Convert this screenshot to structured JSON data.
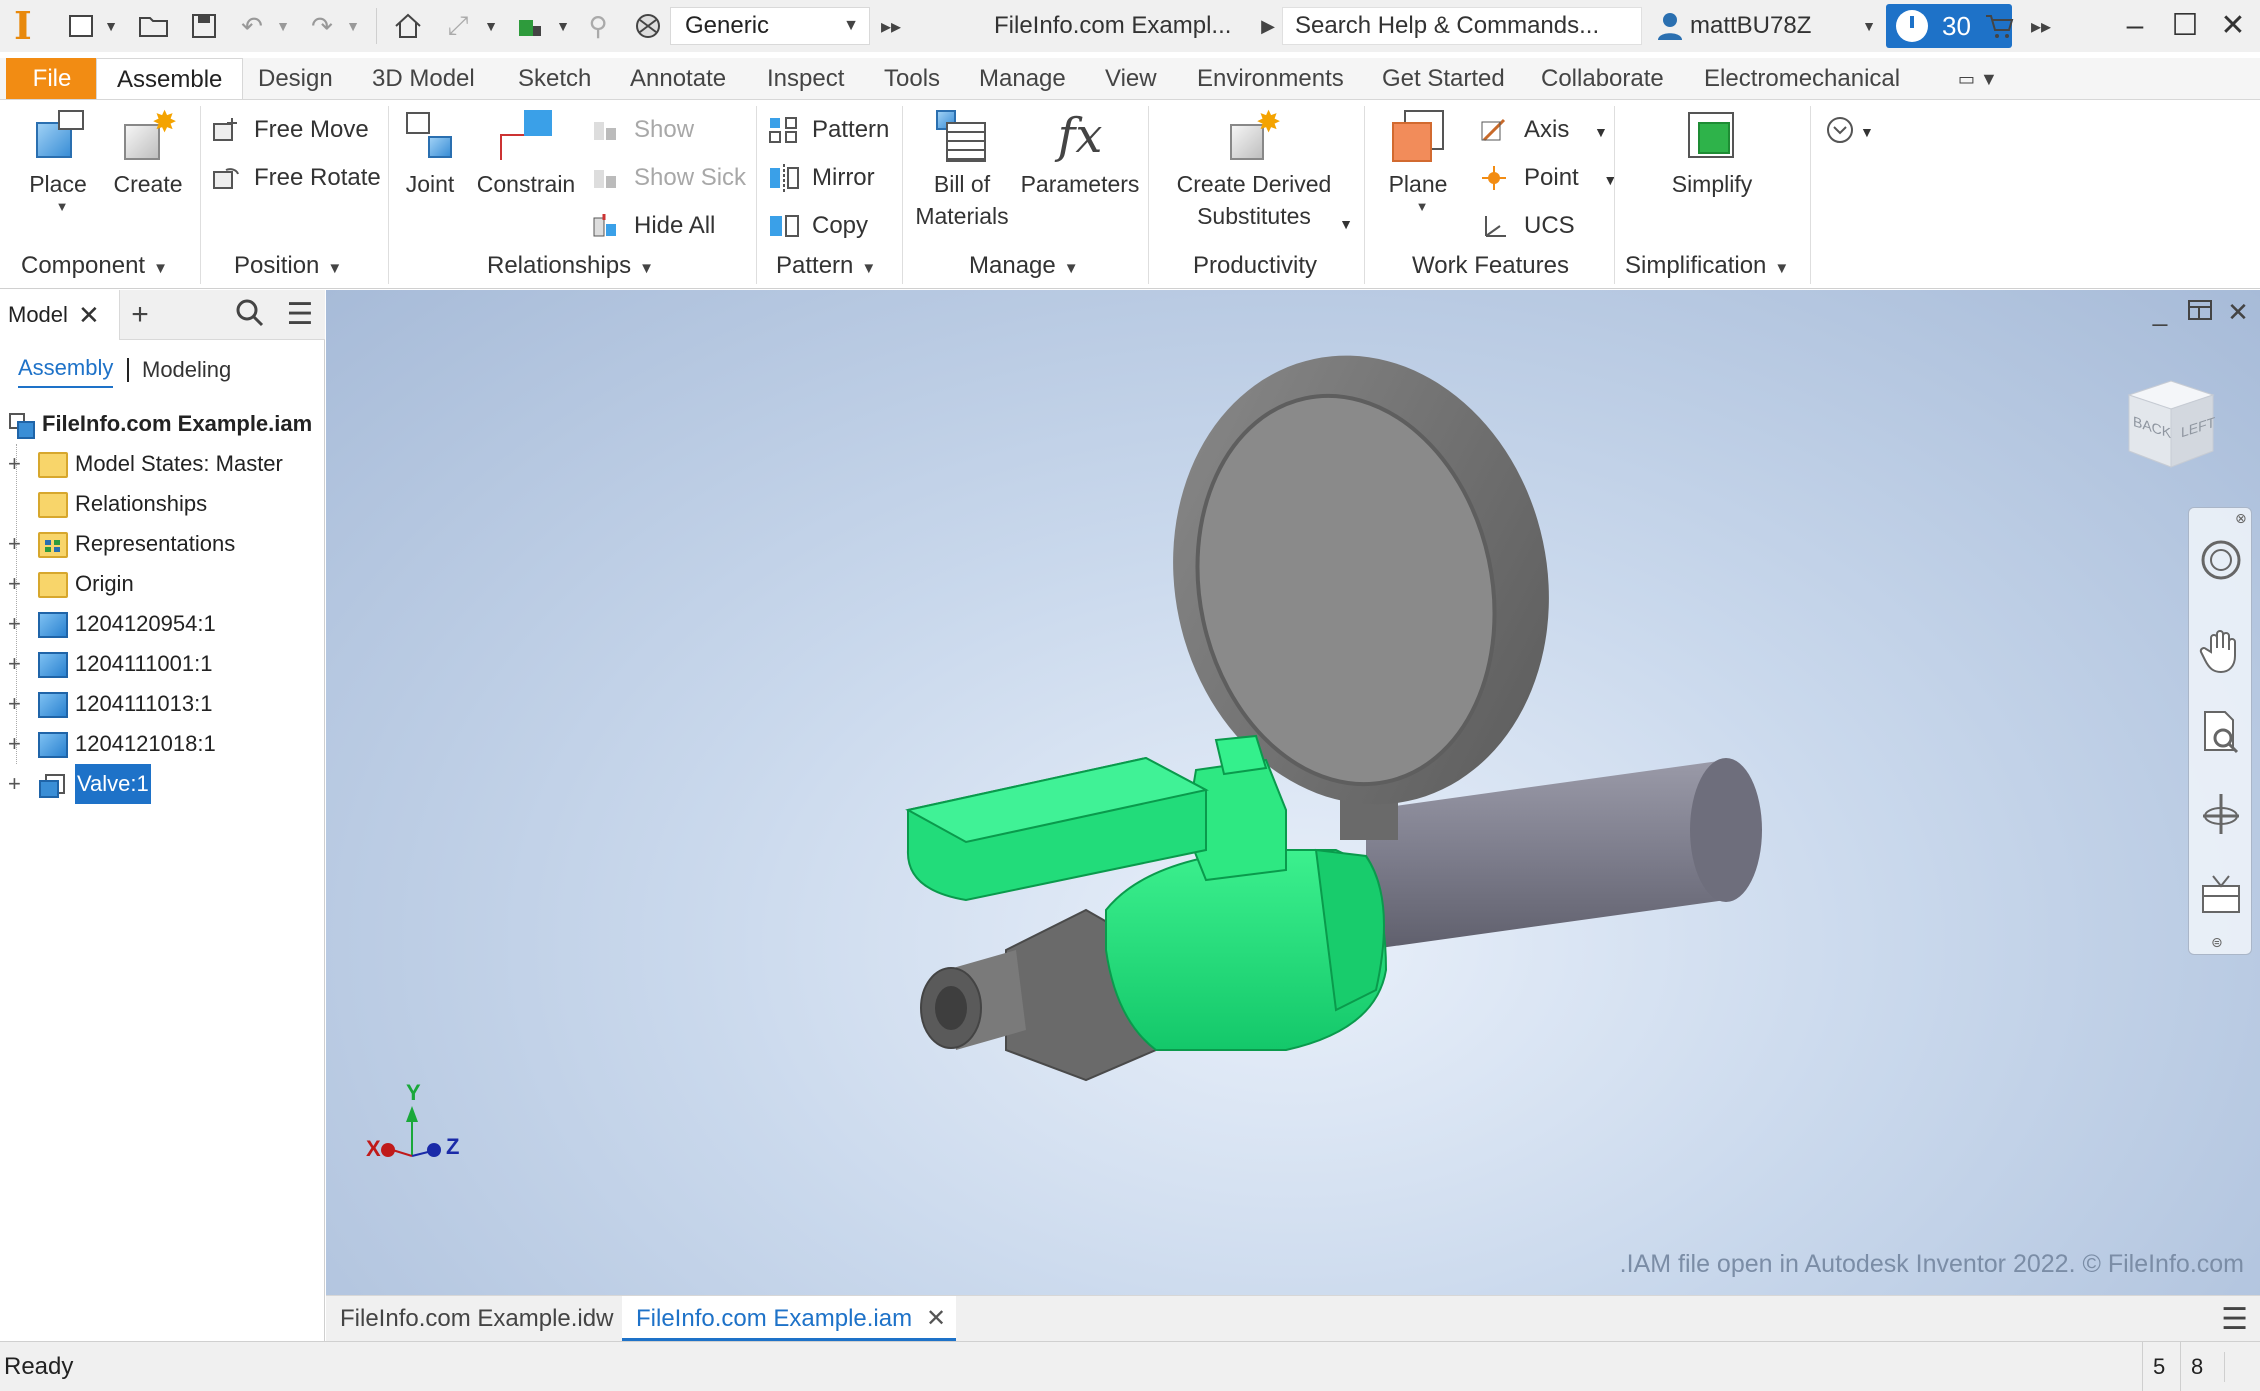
{
  "qat": {
    "appearance": "Generic",
    "window_title": "FileInfo.com Exampl...",
    "search_placeholder": "Search Help & Commands...",
    "user": "mattBU78Z",
    "trial_days": "30"
  },
  "tabs": [
    "File",
    "Assemble",
    "Design",
    "3D Model",
    "Sketch",
    "Annotate",
    "Inspect",
    "Tools",
    "Manage",
    "View",
    "Environments",
    "Get Started",
    "Collaborate",
    "Electromechanical"
  ],
  "ribbon": {
    "component": {
      "place": "Place",
      "create": "Create",
      "label": "Component"
    },
    "position": {
      "free_move": "Free Move",
      "free_rotate": "Free Rotate",
      "label": "Position"
    },
    "relationships": {
      "joint": "Joint",
      "constrain": "Constrain",
      "show": "Show",
      "show_sick": "Show Sick",
      "hide_all": "Hide All",
      "label": "Relationships"
    },
    "pattern": {
      "pattern": "Pattern",
      "mirror": "Mirror",
      "copy": "Copy",
      "label": "Pattern"
    },
    "manage": {
      "bom_1": "Bill of",
      "bom_2": "Materials",
      "parameters": "Parameters",
      "label": "Manage"
    },
    "productivity": {
      "derived_1": "Create Derived",
      "derived_2": "Substitutes",
      "label": "Productivity"
    },
    "work_features": {
      "plane": "Plane",
      "axis": "Axis",
      "point": "Point",
      "ucs": "UCS",
      "label": "Work Features"
    },
    "simplification": {
      "simplify": "Simplify",
      "label": "Simplification"
    }
  },
  "browser": {
    "tab": "Model",
    "mode_assembly": "Assembly",
    "mode_modeling": "Modeling",
    "root": "FileInfo.com Example.iam",
    "items": [
      {
        "label": "Model States: Master",
        "icon": "folder-icon",
        "expandable": true
      },
      {
        "label": "Relationships",
        "icon": "folder-icon",
        "expandable": false
      },
      {
        "label": "Representations",
        "icon": "representations-icon",
        "expandable": true
      },
      {
        "label": "Origin",
        "icon": "folder-icon",
        "expandable": true
      },
      {
        "label": "1204120954:1",
        "icon": "part-icon",
        "expandable": true
      },
      {
        "label": "1204111001:1",
        "icon": "part-icon",
        "expandable": true
      },
      {
        "label": "1204111013:1",
        "icon": "part-icon",
        "expandable": true
      },
      {
        "label": "1204121018:1",
        "icon": "part-icon",
        "expandable": true
      },
      {
        "label": "Valve:1",
        "icon": "subassembly-icon",
        "expandable": true,
        "selected": true
      }
    ]
  },
  "viewport": {
    "viewcube_faces": {
      "back": "BACK",
      "left": "LEFT"
    },
    "triad": {
      "x": "X",
      "y": "Y",
      "z": "Z"
    },
    "watermark": ".IAM file open in Autodesk Inventor 2022. © FileInfo.com",
    "colors": {
      "selected": "#1ee07a",
      "metal": "#6f6f6f",
      "gauge_face": "#8a8a8a"
    }
  },
  "doc_tabs": [
    {
      "label": "FileInfo.com Example.idw",
      "active": false
    },
    {
      "label": "FileInfo.com Example.iam",
      "active": true
    }
  ],
  "status": {
    "text": "Ready",
    "num1": "5",
    "num2": "8"
  }
}
